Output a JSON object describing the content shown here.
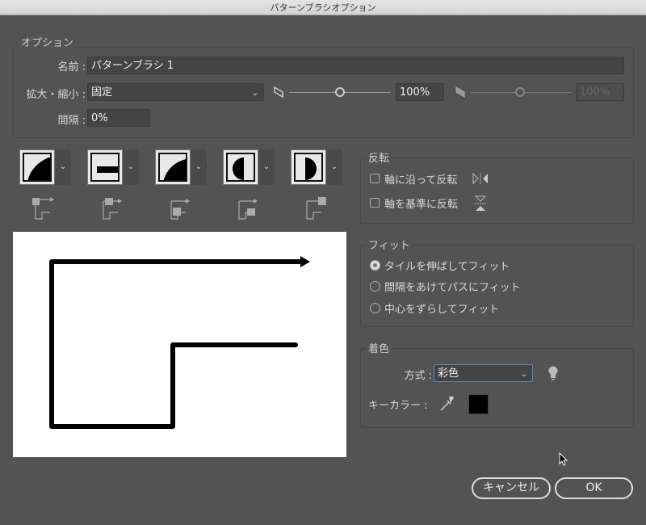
{
  "window": {
    "title": "パターンブラシオプション"
  },
  "options": {
    "group_label": "オプション",
    "name_label": "名前 :",
    "name_value": "パターンブラシ 1",
    "scale_label": "拡大・縮小 :",
    "scale_value": "固定",
    "scale_percent": "100%",
    "scale_percent_disabled": "100%",
    "scale_slider_value": 100,
    "spacing_label": "間隔 :",
    "spacing_value": "0%"
  },
  "tiles": [
    {
      "name": "side-tile"
    },
    {
      "name": "outer-corner-tile"
    },
    {
      "name": "inner-corner-tile"
    },
    {
      "name": "start-tile"
    },
    {
      "name": "end-tile"
    }
  ],
  "flip": {
    "group_label": "反転",
    "along": "軸に沿って反転",
    "across": "軸を基準に反転",
    "along_checked": false,
    "across_checked": false
  },
  "fit": {
    "group_label": "フィット",
    "options": [
      "タイルを伸ばしてフィット",
      "間隔をあけてパスにフィット",
      "中心をずらしてフィット"
    ],
    "selected": 0
  },
  "colorization": {
    "group_label": "着色",
    "method_label": "方式 :",
    "method_value": "彩色",
    "key_color_label": "キーカラー :",
    "key_color": "#000000"
  },
  "buttons": {
    "cancel": "キャンセル",
    "ok": "OK"
  }
}
